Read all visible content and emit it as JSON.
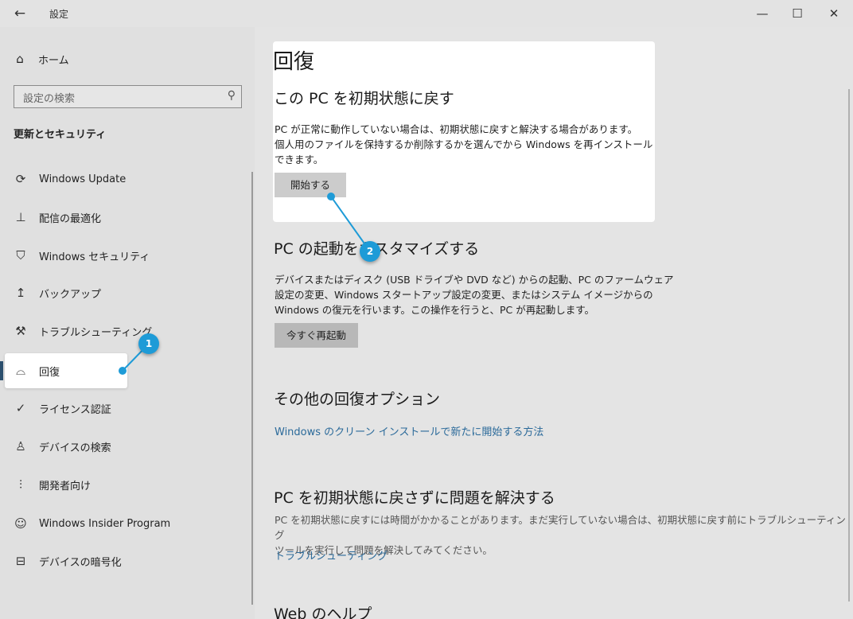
{
  "window": {
    "title": "設定",
    "back_glyph": "←",
    "minimize_glyph": "—",
    "maximize_glyph": "☐",
    "close_glyph": "✕"
  },
  "sidebar": {
    "home_label": "ホーム",
    "search_placeholder": "設定の検索",
    "section_title": "更新とセキュリティ",
    "items": [
      {
        "label": "Windows Update",
        "icon": "refresh-icon"
      },
      {
        "label": "配信の最適化",
        "icon": "delivery-optimization-icon"
      },
      {
        "label": "Windows セキュリティ",
        "icon": "shield-icon"
      },
      {
        "label": "バックアップ",
        "icon": "backup-arrow-icon"
      },
      {
        "label": "トラブルシューティング",
        "icon": "wrench-icon"
      },
      {
        "label": "回復",
        "icon": "recovery-icon"
      },
      {
        "label": "ライセンス認証",
        "icon": "check-circle-icon"
      },
      {
        "label": "デバイスの検索",
        "icon": "person-location-icon"
      },
      {
        "label": "開発者向け",
        "icon": "developer-sliders-icon"
      },
      {
        "label": "Windows Insider Program",
        "icon": "insider-cat-icon"
      },
      {
        "label": "デバイスの暗号化",
        "icon": "encryption-icon"
      }
    ]
  },
  "main": {
    "page_title": "回復",
    "reset": {
      "heading": "この PC を初期状態に戻す",
      "line1": "PC が正常に動作していない場合は、初期状態に戻すと解決する場合があります。",
      "line2": "個人用のファイルを保持するか削除するかを選んでから Windows を再インストール",
      "line3": "できます。",
      "button": "開始する"
    },
    "advanced": {
      "heading": "PC の起動をカスタマイズする",
      "line1": "デバイスまたはディスク (USB ドライブや DVD など) からの起動、PC のファームウェア",
      "line2": "設定の変更、Windows スタートアップ設定の変更、またはシステム イメージからの",
      "line3": "Windows の復元を行います。この操作を行うと、PC が再起動します。",
      "button": "今すぐ再起動"
    },
    "other": {
      "heading": "その他の回復オプション",
      "link": "Windows のクリーン インストールで新たに開始する方法"
    },
    "fix": {
      "heading": "PC を初期状態に戻さずに問題を解決する",
      "line1": "PC を初期状態に戻すには時間がかかることがあります。まだ実行していない場合は、初期状態に戻す前にトラブルシューティング",
      "line2": "ツールを実行して問題を解決してみてください。",
      "link": "トラブルシューティング"
    },
    "web_help": {
      "heading": "Web のヘルプ"
    }
  },
  "annotations": {
    "badge1": "1",
    "badge2": "2",
    "color": "#1e9bd7"
  }
}
